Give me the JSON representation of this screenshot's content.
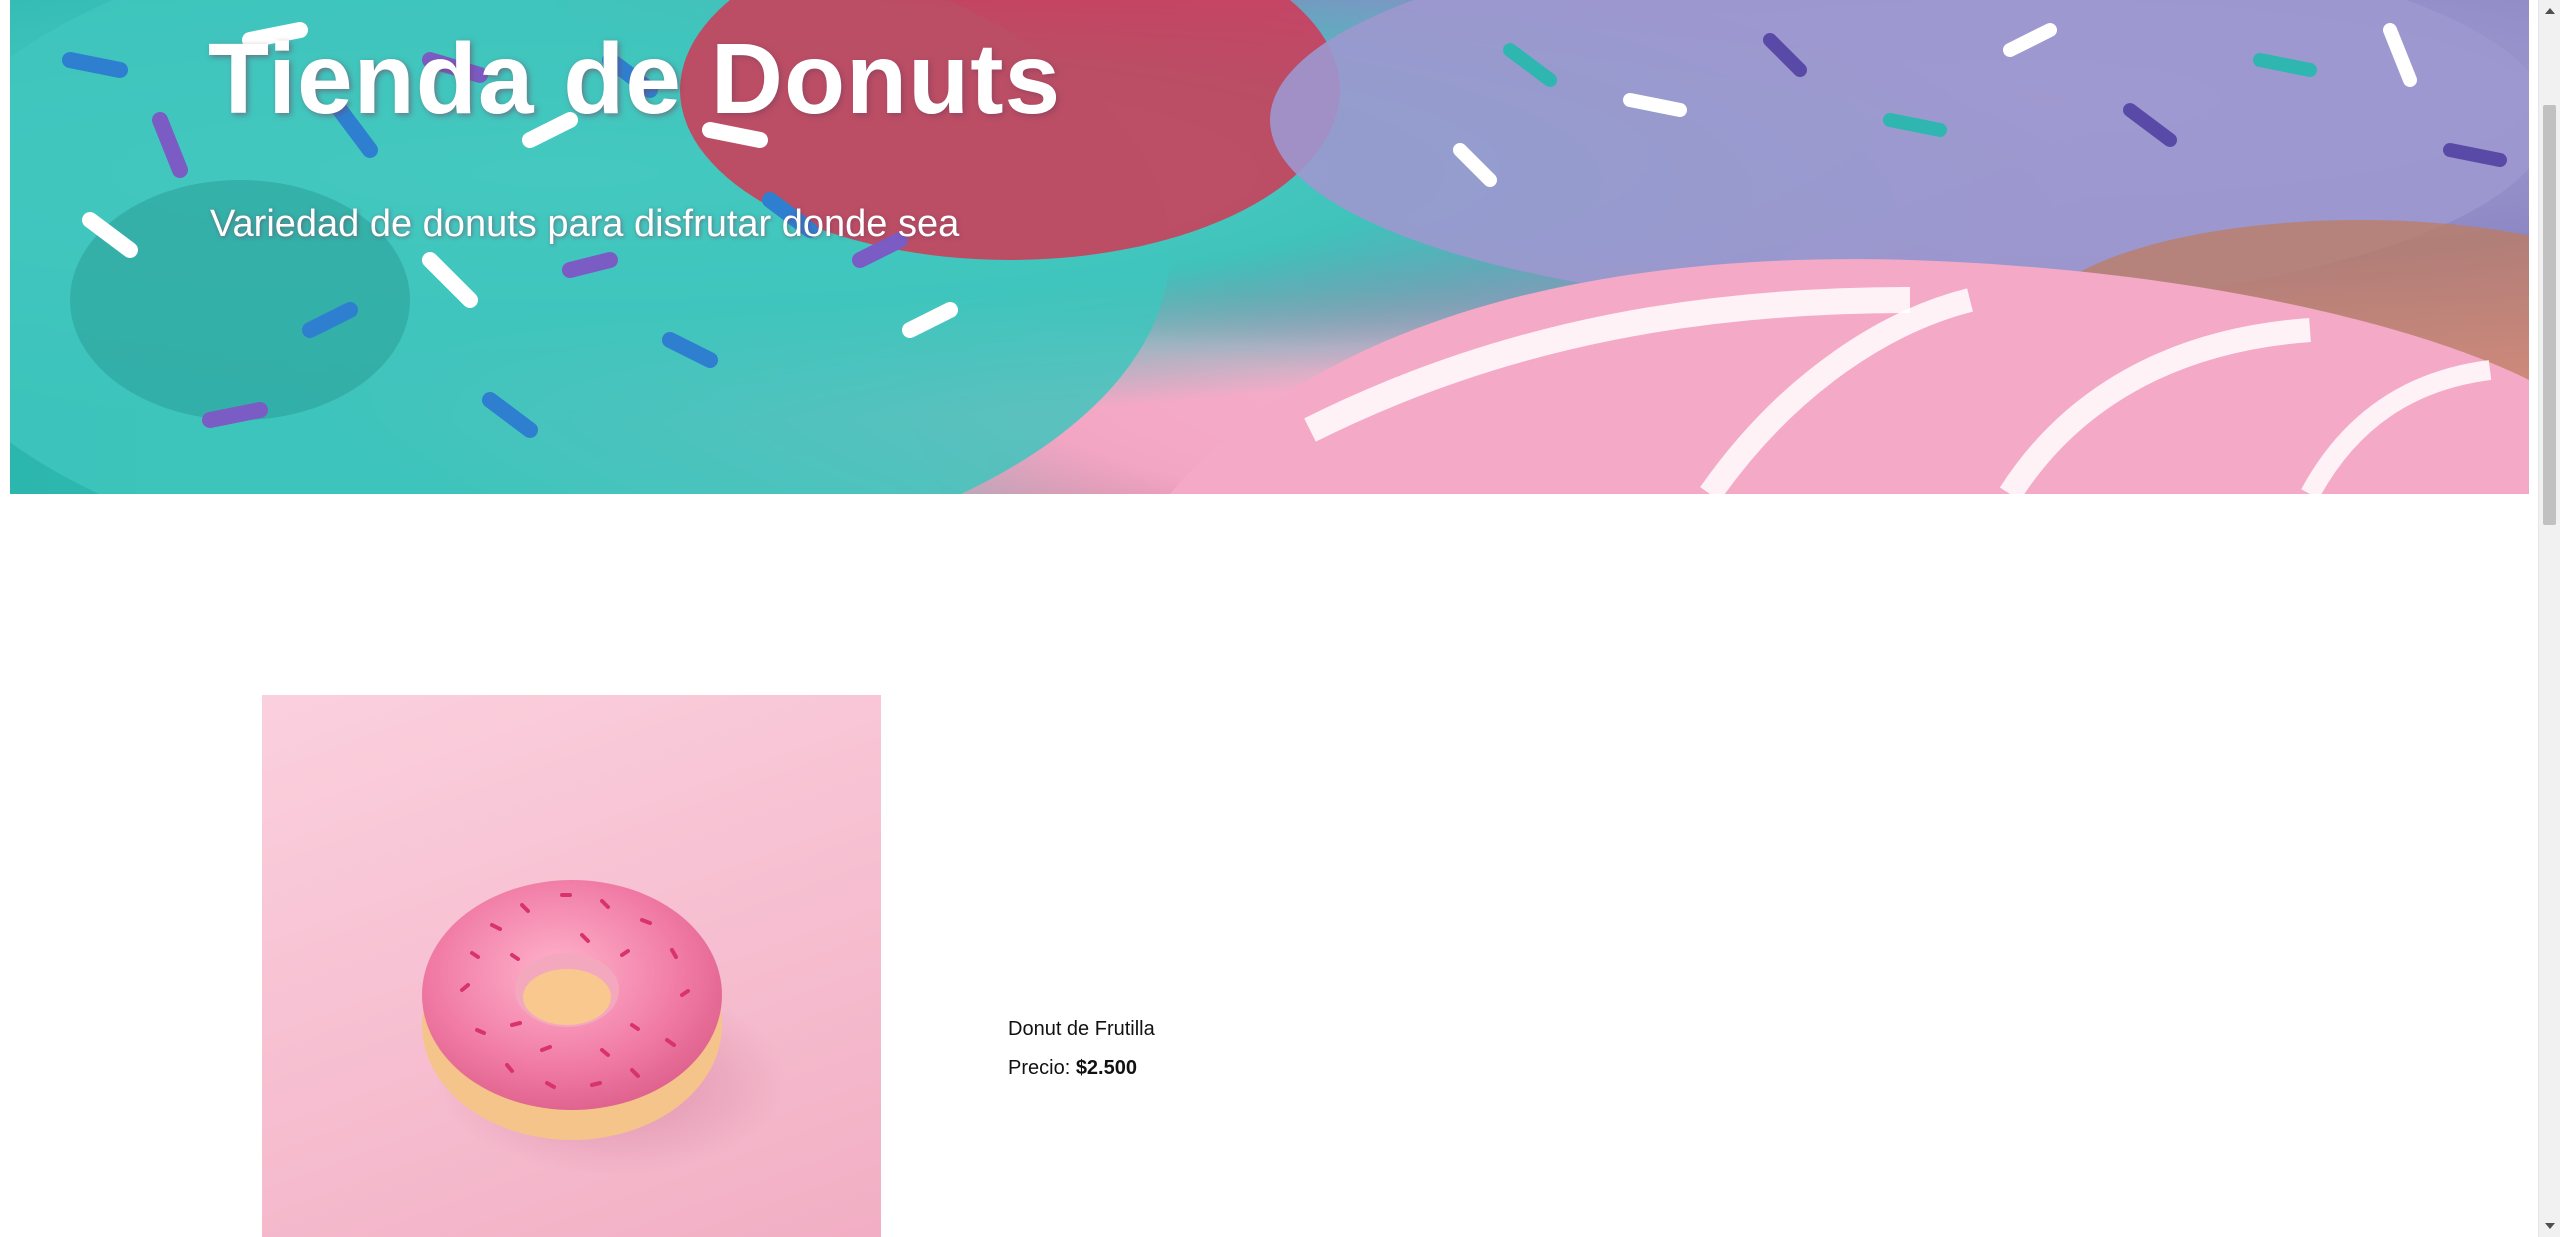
{
  "hero": {
    "title": "Tienda de Donuts",
    "subtitle": "Variedad de donuts para disfrutar donde sea",
    "image_icon": "donuts-banner-image"
  },
  "product": {
    "name": "Donut de Frutilla",
    "price_label": "Precio:",
    "price_value": "$2.500",
    "image_icon": "pink-donut-image"
  },
  "colors": {
    "text": "#111111",
    "hero_text": "#ffffff",
    "background": "#ffffff",
    "product_bg": "#f6bed0"
  }
}
